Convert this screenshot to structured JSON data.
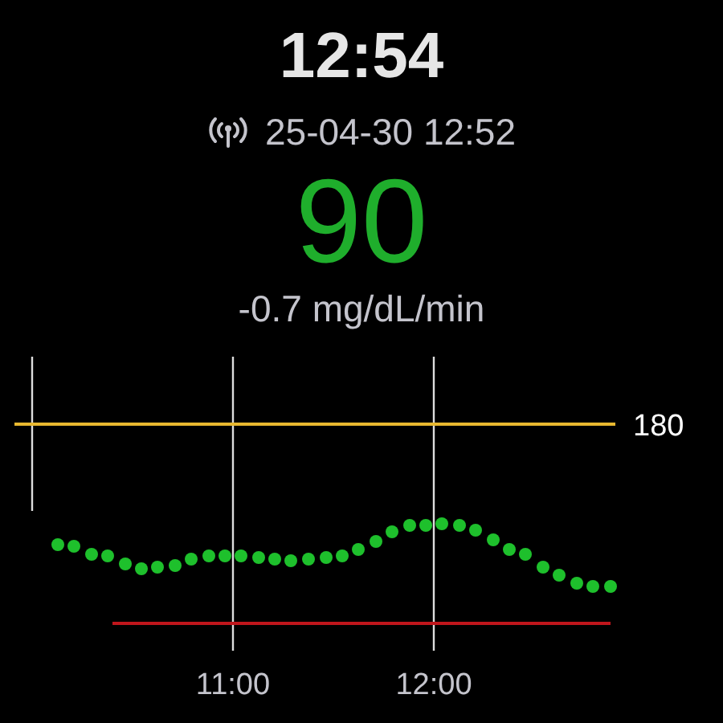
{
  "time": "12:54",
  "reading": {
    "timestamp": "25-04-30 12:52",
    "value": "90",
    "trend": "-0.7 mg/dL/min"
  },
  "graph": {
    "high_label": "180",
    "time_labels": [
      "11:00",
      "12:00"
    ]
  }
}
